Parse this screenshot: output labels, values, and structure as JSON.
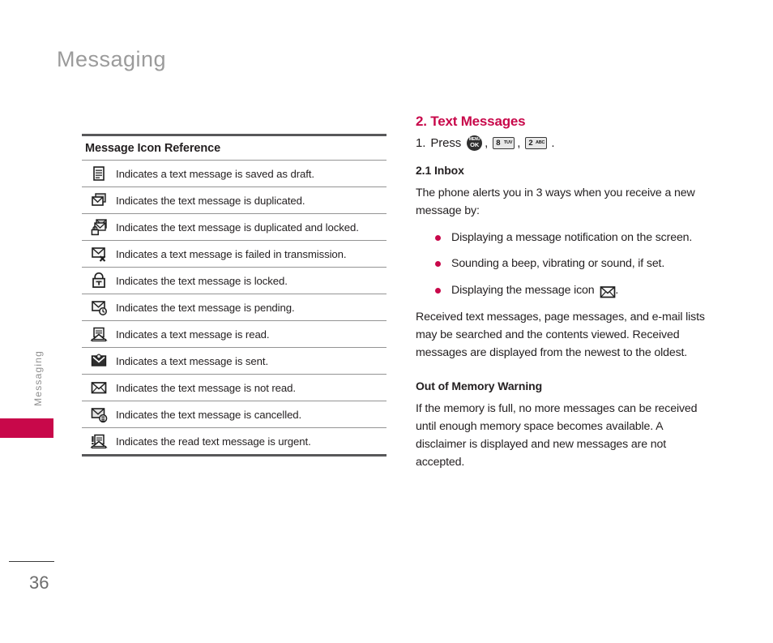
{
  "page": {
    "title": "Messaging",
    "side_tab_label": "Messaging",
    "number": "36"
  },
  "icon_table": {
    "header": "Message Icon Reference",
    "rows": [
      {
        "icon": "draft-message-icon",
        "description": "Indicates a text message is saved as draft."
      },
      {
        "icon": "duplicated-message-icon",
        "description": "Indicates the text message is duplicated."
      },
      {
        "icon": "duplicated-locked-message-icon",
        "description": "Indicates the text message is duplicated and locked."
      },
      {
        "icon": "failed-message-icon",
        "description": "Indicates a text message is failed in transmission."
      },
      {
        "icon": "locked-message-icon",
        "description": "Indicates the text message is locked."
      },
      {
        "icon": "pending-message-icon",
        "description": "Indicates the text message is pending."
      },
      {
        "icon": "read-message-icon",
        "description": "Indicates a text message is read."
      },
      {
        "icon": "sent-message-icon",
        "description": "Indicates a text message is sent."
      },
      {
        "icon": "unread-message-icon",
        "description": "Indicates the text message is not read."
      },
      {
        "icon": "cancelled-message-icon",
        "description": "Indicates the text message is cancelled."
      },
      {
        "icon": "urgent-read-message-icon",
        "description": "Indicates the read text message is urgent."
      }
    ]
  },
  "content": {
    "section_heading": "2. Text Messages",
    "step": {
      "number": "1.",
      "verb": "Press",
      "key_menu_top": "MENU",
      "key_menu_bottom": "OK",
      "key_8_digit": "8",
      "key_8_letters": "TUV",
      "key_2_digit": "2",
      "key_2_letters": "ABC",
      "separator": ",",
      "terminator": "."
    },
    "inbox_heading": "2.1 Inbox",
    "intro_paragraph": "The phone alerts you in 3 ways when you receive a new message by:",
    "bullets": [
      {
        "text": "Displaying a message notification on the screen.",
        "icon": null
      },
      {
        "text": "Sounding a beep, vibrating or sound, if set.",
        "icon": null
      },
      {
        "text": "Displaying the message icon",
        "icon": "unread-message-icon",
        "suffix": "."
      }
    ],
    "received_paragraph": "Received text messages, page messages, and e-mail lists may be searched and the contents viewed. Received messages are displayed from the newest to the oldest.",
    "memory_heading": "Out of Memory Warning",
    "memory_paragraph": "If the memory is full, no more messages can be received until enough memory space becomes available. A disclaimer is displayed and new messages are not accepted."
  },
  "colors": {
    "accent": "#c8084a",
    "title_gray": "#9b9b9b",
    "body_text": "#231f20",
    "rule_dark": "#58585a",
    "rule_light": "#949494"
  }
}
